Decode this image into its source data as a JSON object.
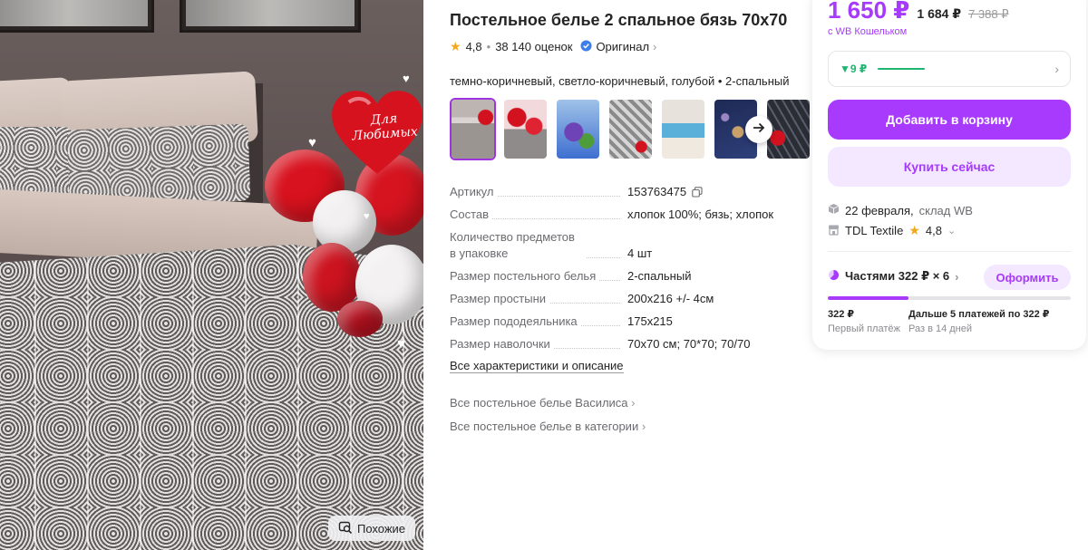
{
  "product": {
    "title": "Постельное белье 2 спальное бязь 70х70",
    "rating": "4,8",
    "reviews": "38 140 оценок",
    "original_label": "Оригинал",
    "colors_line": "темно-коричневый, светло-коричневый, голубой • 2-спальный",
    "photo_text": "Для Любимых",
    "similar_label": "Похожие",
    "thumbnails": [
      "thumb-grey",
      "thumb-red-hearts",
      "thumb-blue-roses",
      "thumb-grey-print",
      "thumb-beach",
      "thumb-navy",
      "thumb-dark-red"
    ]
  },
  "specs": [
    {
      "key": "Артикул",
      "value": "153763475"
    },
    {
      "key": "Состав",
      "value": "хлопок 100%; бязь; хлопок"
    },
    {
      "key": "Количество предметов в упаковке",
      "value": "4 шт"
    },
    {
      "key": "Размер постельного белья",
      "value": "2-спальный"
    },
    {
      "key": "Размер простыни",
      "value": "200х216 +/- 4см"
    },
    {
      "key": "Размер пододеяльника",
      "value": "175х215"
    },
    {
      "key": "Размер наволочки",
      "value": "70х70 см; 70*70; 70/70"
    }
  ],
  "links": {
    "all_chars": "Все характеристики и описание",
    "all_brand": "Все постельное белье Василиса",
    "all_category": "Все постельное белье в категории"
  },
  "purchase": {
    "price": "1 650 ₽",
    "price_alt": "1 684 ₽",
    "price_old": "7 388 ₽",
    "wallet_note": "с WB Кошельком",
    "cashback": "▼9 ₽",
    "add_to_cart": "Добавить в корзину",
    "buy_now": "Купить сейчас",
    "delivery": "22 февраля,",
    "warehouse": "склад WB",
    "seller": "TDL Textile",
    "seller_rating": "4,8",
    "installments": "Частями 322 ₽ × 6",
    "installments_btn": "Оформить",
    "installments_progress": 0.333,
    "first_payment_amount": "322 ₽",
    "first_payment_label": "Первый платёж",
    "next_payments_amount": "Дальше 5 платежей по 322 ₽",
    "next_payments_label": "Раз в 14 дней"
  },
  "colors": {
    "accent": "#a73afd",
    "accent_light": "#f3e8ff",
    "cashback_green": "#1db56f",
    "star": "#f0a81c"
  }
}
